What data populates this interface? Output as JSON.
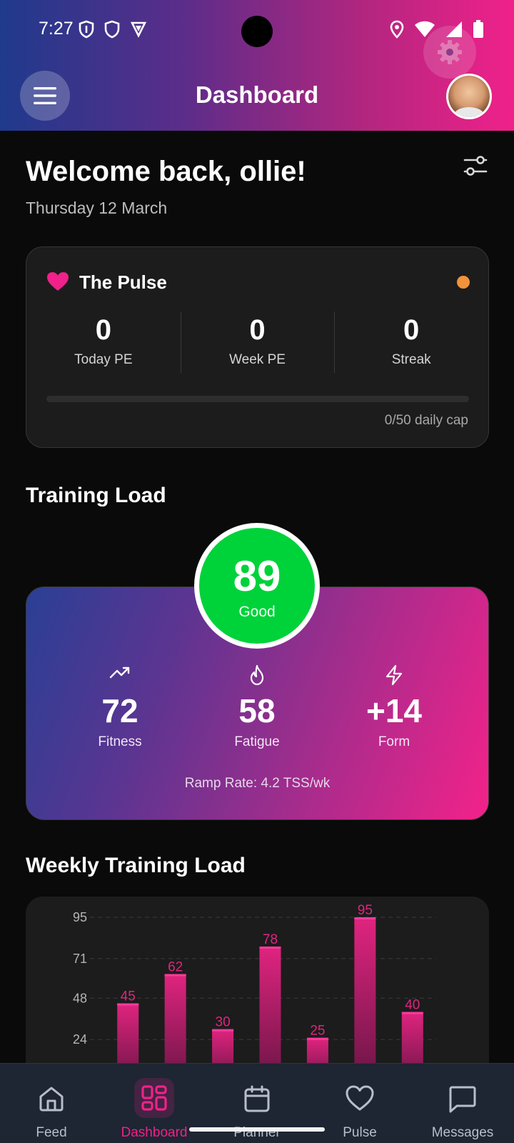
{
  "status_bar": {
    "time": "7:27"
  },
  "header": {
    "title": "Dashboard"
  },
  "welcome": {
    "greeting": "Welcome back, ollie!",
    "date": "Thursday 12 March"
  },
  "pulse": {
    "title": "The Pulse",
    "stats": [
      {
        "value": "0",
        "label": "Today PE"
      },
      {
        "value": "0",
        "label": "Week PE"
      },
      {
        "value": "0",
        "label": "Streak"
      }
    ],
    "progress": 0,
    "cap_text": "0/50 daily cap",
    "status_color": "#f2923b"
  },
  "training_load": {
    "title": "Training Load",
    "score": "89",
    "score_label": "Good",
    "score_color": "#00d23a",
    "metrics": [
      {
        "icon": "trending-up-icon",
        "value": "72",
        "label": "Fitness"
      },
      {
        "icon": "flame-icon",
        "value": "58",
        "label": "Fatigue"
      },
      {
        "icon": "zap-icon",
        "value": "+14",
        "label": "Form"
      }
    ],
    "ramp_rate": "Ramp Rate: 4.2 TSS/wk"
  },
  "weekly": {
    "title": "Weekly Training Load"
  },
  "chart_data": {
    "type": "bar",
    "values": [
      45,
      62,
      30,
      78,
      25,
      95,
      40
    ],
    "y_ticks": [
      95,
      71,
      48,
      24
    ],
    "ylim": [
      0,
      95
    ],
    "grid": true,
    "bar_color": "#e0247f"
  },
  "nav": {
    "items": [
      {
        "label": "Feed",
        "icon": "home-icon",
        "active": false
      },
      {
        "label": "Dashboard",
        "icon": "dashboard-icon",
        "active": true
      },
      {
        "label": "Planner",
        "icon": "calendar-icon",
        "active": false
      },
      {
        "label": "Pulse",
        "icon": "heart-icon",
        "active": false
      },
      {
        "label": "Messages",
        "icon": "message-icon",
        "active": false
      }
    ]
  },
  "colors": {
    "accent": "#f0218a",
    "background": "#0a0a0a",
    "card": "#1c1c1c"
  }
}
